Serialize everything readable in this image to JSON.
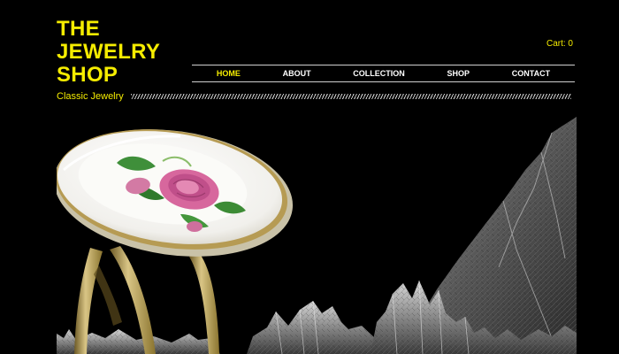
{
  "header": {
    "logo_text": "THE JEWELRY SHOP",
    "tagline": "Classic Jewelry",
    "cart_label": "Cart: 0"
  },
  "nav": {
    "items": [
      {
        "label": "HOME",
        "active": true
      },
      {
        "label": "ABOUT",
        "active": false
      },
      {
        "label": "COLLECTION",
        "active": false
      },
      {
        "label": "SHOP",
        "active": false
      },
      {
        "label": "CONTACT",
        "active": false
      }
    ]
  },
  "colors": {
    "accent": "#f5ec00",
    "background": "#000000",
    "nav_text": "#ffffff",
    "rule": "#cfcfcf"
  }
}
